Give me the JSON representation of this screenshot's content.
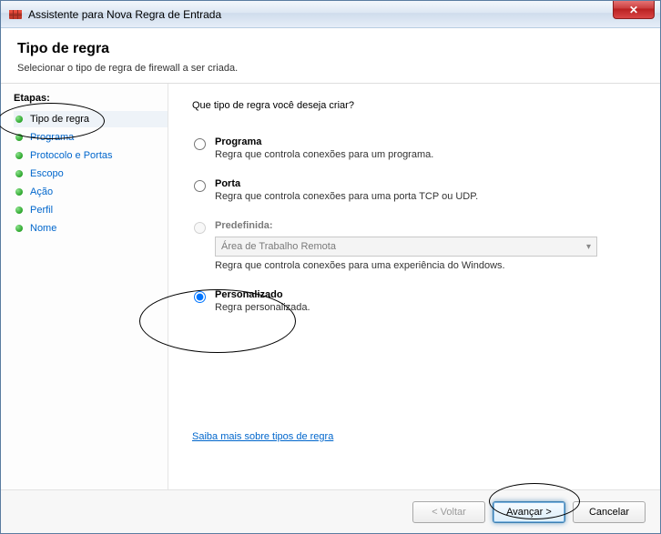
{
  "window": {
    "title": "Assistente para Nova Regra de Entrada"
  },
  "header": {
    "title": "Tipo de regra",
    "subtitle": "Selecionar o tipo de regra de firewall a ser criada."
  },
  "sidebar": {
    "steps_label": "Etapas:",
    "items": [
      {
        "label": "Tipo de regra",
        "current": true
      },
      {
        "label": "Programa"
      },
      {
        "label": "Protocolo e Portas"
      },
      {
        "label": "Escopo"
      },
      {
        "label": "Ação"
      },
      {
        "label": "Perfil"
      },
      {
        "label": "Nome"
      }
    ]
  },
  "main": {
    "prompt": "Que tipo de regra você deseja criar?",
    "options": {
      "program": {
        "title": "Programa",
        "desc": "Regra que controla conexões para um programa."
      },
      "port": {
        "title": "Porta",
        "desc": "Regra que controla conexões para uma porta TCP ou UDP."
      },
      "predefined": {
        "title": "Predefinida:",
        "select_value": "Área de Trabalho Remota",
        "desc": "Regra que controla conexões para uma experiência do Windows."
      },
      "custom": {
        "title": "Personalizado",
        "desc": "Regra personalizada."
      }
    },
    "learn_more": "Saiba mais sobre tipos de regra"
  },
  "footer": {
    "back": "< Voltar",
    "next": "Avançar >",
    "cancel": "Cancelar"
  }
}
